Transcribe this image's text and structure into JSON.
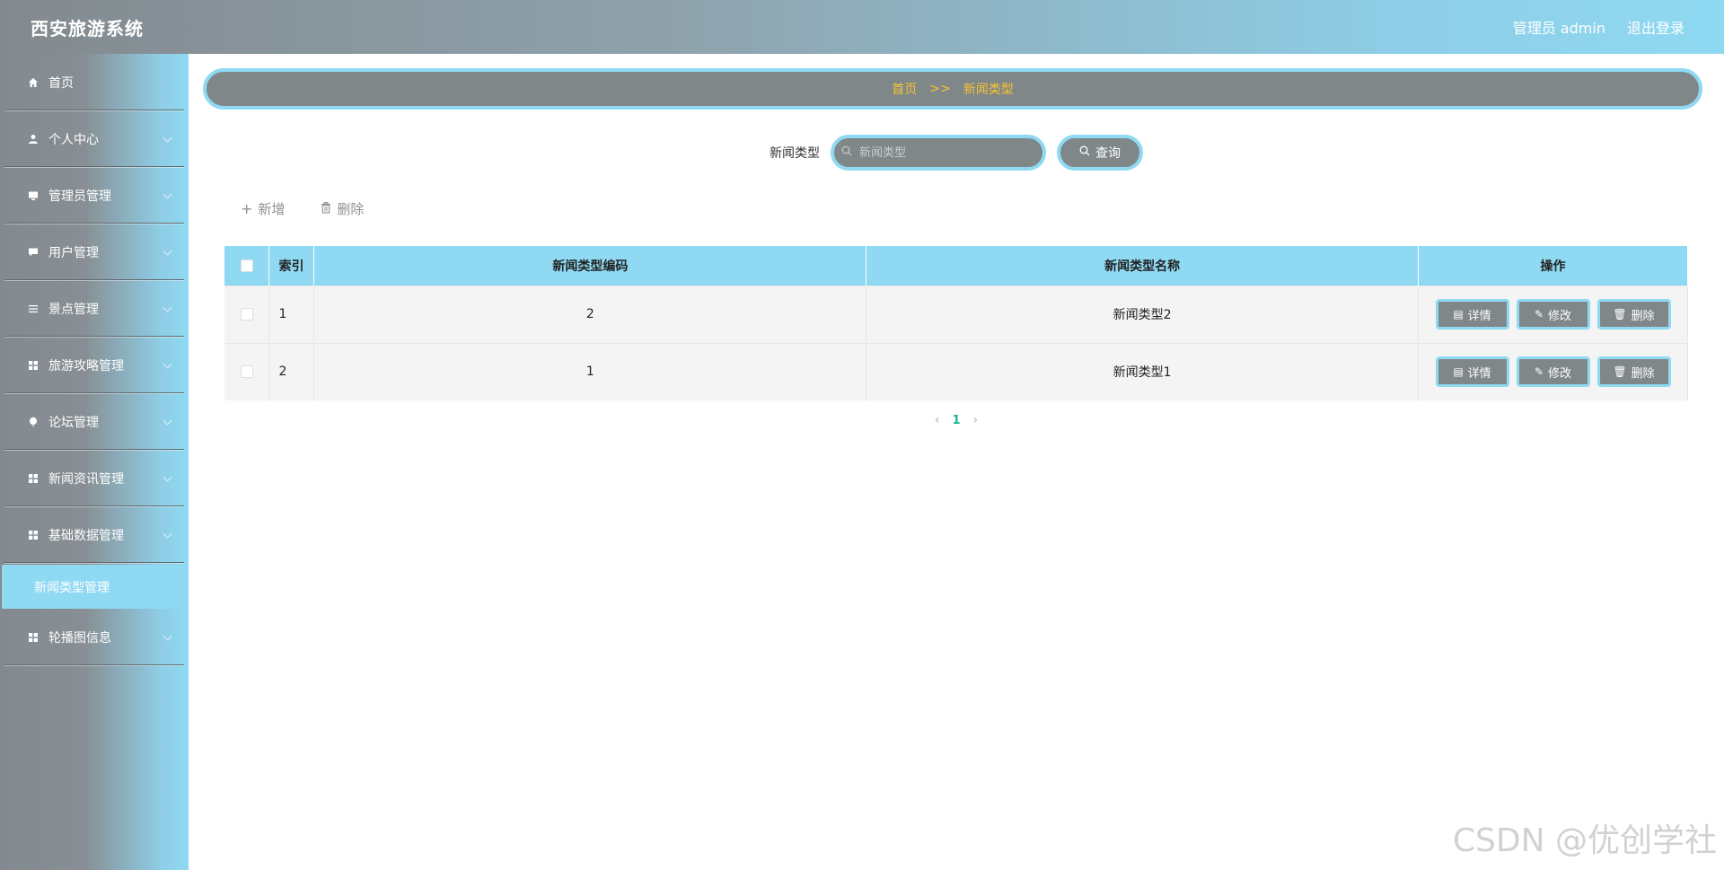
{
  "header": {
    "brand": "西安旅游系统",
    "user_label": "管理员 admin",
    "logout_label": "退出登录"
  },
  "sidebar": {
    "items": [
      {
        "label": "首页",
        "icon": "home-icon",
        "has_chevron": false
      },
      {
        "label": "个人中心",
        "icon": "user-icon",
        "has_chevron": true
      },
      {
        "label": "管理员管理",
        "icon": "monitor-icon",
        "has_chevron": true
      },
      {
        "label": "用户管理",
        "icon": "chat-icon",
        "has_chevron": true
      },
      {
        "label": "景点管理",
        "icon": "list-icon",
        "has_chevron": true
      },
      {
        "label": "旅游攻略管理",
        "icon": "grid-icon",
        "has_chevron": true
      },
      {
        "label": "论坛管理",
        "icon": "balloon-icon",
        "has_chevron": true
      },
      {
        "label": "新闻资讯管理",
        "icon": "grid-icon",
        "has_chevron": true
      },
      {
        "label": "基础数据管理",
        "icon": "grid-icon",
        "has_chevron": true
      },
      {
        "label": "轮播图信息",
        "icon": "grid-icon",
        "has_chevron": true
      }
    ],
    "active_submenu": "新闻类型管理"
  },
  "breadcrumb": {
    "home": "首页",
    "separator": ">>",
    "current": "新闻类型"
  },
  "search": {
    "label": "新闻类型",
    "placeholder": "新闻类型",
    "value": "",
    "button_label": "查询"
  },
  "toolbar": {
    "add_label": "新增",
    "delete_label": "删除"
  },
  "table": {
    "columns": [
      "索引",
      "新闻类型编码",
      "新闻类型名称",
      "操作"
    ],
    "rows": [
      {
        "index": "1",
        "code": "2",
        "name": "新闻类型2"
      },
      {
        "index": "2",
        "code": "1",
        "name": "新闻类型1"
      }
    ],
    "actions": {
      "detail": "详情",
      "edit": "修改",
      "delete": "删除"
    }
  },
  "pagination": {
    "current_page": "1"
  },
  "watermark": "CSDN @优创学社",
  "colors": {
    "accent": "#8fd9f2",
    "panel": "#808789",
    "breadcrumb_text": "#f6c531",
    "page_active": "#1ab394"
  }
}
